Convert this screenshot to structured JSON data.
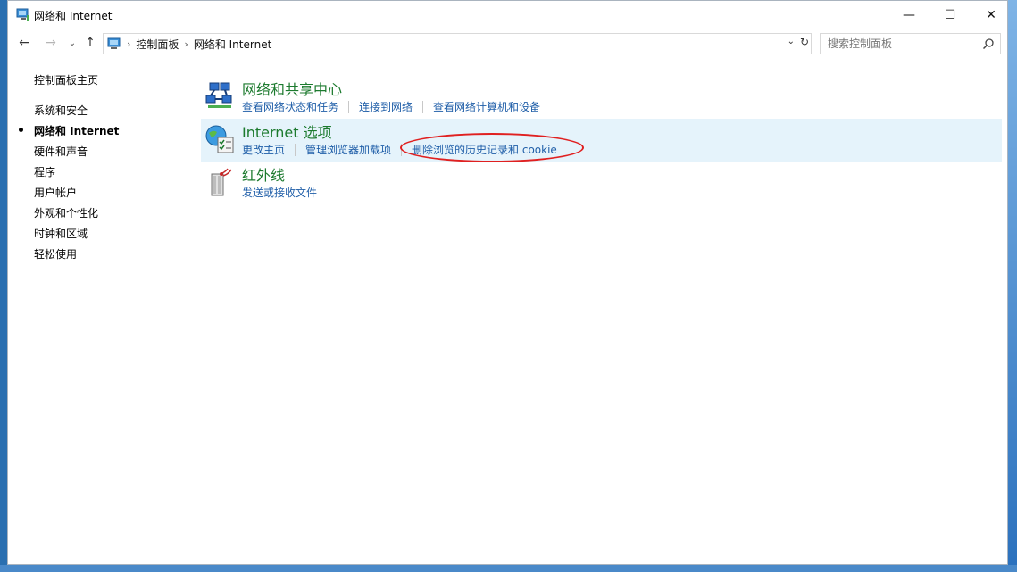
{
  "window": {
    "title": "网络和 Internet",
    "controls": {
      "minimize": "—",
      "maximize": "☐",
      "close": "✕"
    }
  },
  "nav": {
    "back": "←",
    "forward": "→",
    "recent": "⌄",
    "up": "↑",
    "breadcrumbs": [
      "控制面板",
      "网络和 Internet"
    ],
    "separator": "›",
    "dropdown": "⌄",
    "refresh": "↻",
    "search_placeholder": "搜索控制面板"
  },
  "sidebar": {
    "home": "控制面板主页",
    "items": [
      {
        "label": "系统和安全",
        "active": false
      },
      {
        "label": "网络和 Internet",
        "active": true
      },
      {
        "label": "硬件和声音",
        "active": false
      },
      {
        "label": "程序",
        "active": false
      },
      {
        "label": "用户帐户",
        "active": false
      },
      {
        "label": "外观和个性化",
        "active": false
      },
      {
        "label": "时钟和区域",
        "active": false
      },
      {
        "label": "轻松使用",
        "active": false
      }
    ]
  },
  "categories": [
    {
      "title": "网络和共享中心",
      "icon": "network-sharing-icon",
      "links": [
        "查看网络状态和任务",
        "连接到网络",
        "查看网络计算机和设备"
      ],
      "highlighted": false
    },
    {
      "title": "Internet 选项",
      "icon": "internet-options-icon",
      "links": [
        "更改主页",
        "管理浏览器加载项",
        "删除浏览的历史记录和 cookie"
      ],
      "highlighted": true
    },
    {
      "title": "红外线",
      "icon": "infrared-icon",
      "links": [
        "发送或接收文件"
      ],
      "highlighted": false
    }
  ],
  "colors": {
    "category_title": "#1c7a2e",
    "link": "#1f5ea8",
    "highlight_bg": "#e5f3fb",
    "annotation_ellipse": "#e02020"
  }
}
